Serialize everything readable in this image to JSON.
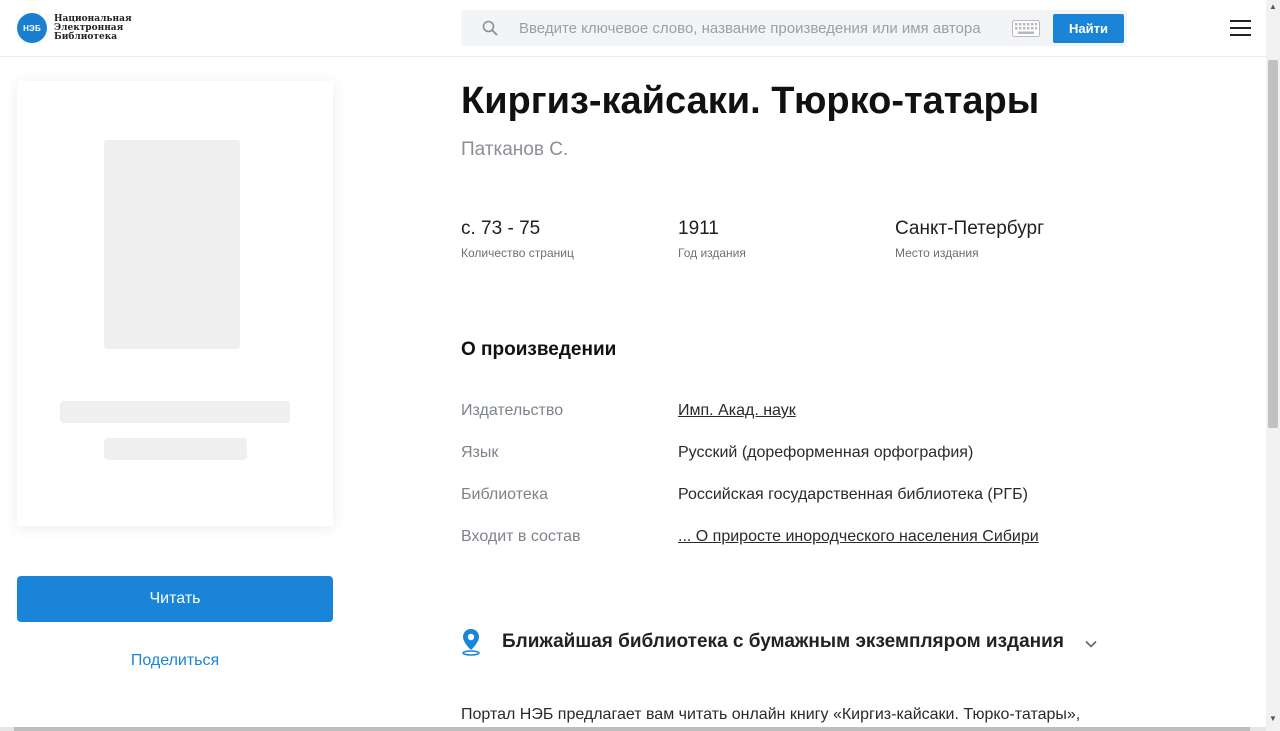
{
  "header": {
    "logo_badge": "НЭБ",
    "logo_text": "Национальная\nЭлектронная\nБиблиотека",
    "search_placeholder": "Введите ключевое слово, название произведения или имя автора",
    "search_button": "Найти"
  },
  "book": {
    "title": "Киргиз-кайсаки. Тюрко-татары",
    "author": "Патканов С.",
    "stats": [
      {
        "value": "с. 73 - 75",
        "label": "Количество страниц"
      },
      {
        "value": "1911",
        "label": "Год издания"
      },
      {
        "value": "Санкт-Петербург",
        "label": "Место издания"
      }
    ]
  },
  "left": {
    "read_button": "Читать",
    "share_link": "Поделиться"
  },
  "about": {
    "title": "О произведении",
    "props": [
      {
        "label": "Издательство",
        "value": "Имп. Акад. наук",
        "link": true
      },
      {
        "label": "Язык",
        "value": "Русский (дореформенная орфография)",
        "link": false
      },
      {
        "label": "Библиотека",
        "value": "Российская государственная библиотека (РГБ)",
        "link": false
      },
      {
        "label": "Входит в состав",
        "value": "... О приросте инородческого населения Сибири",
        "link": true
      }
    ]
  },
  "nearest": {
    "title": "Ближайшая библиотека с бумажным экземпляром издания"
  },
  "description": "Портал НЭБ предлагает вам читать онлайн книгу «Киргиз-кайсаки. Тюрко-татары»,",
  "colors": {
    "accent": "#1a84d8",
    "muted_text": "#7d838a"
  }
}
